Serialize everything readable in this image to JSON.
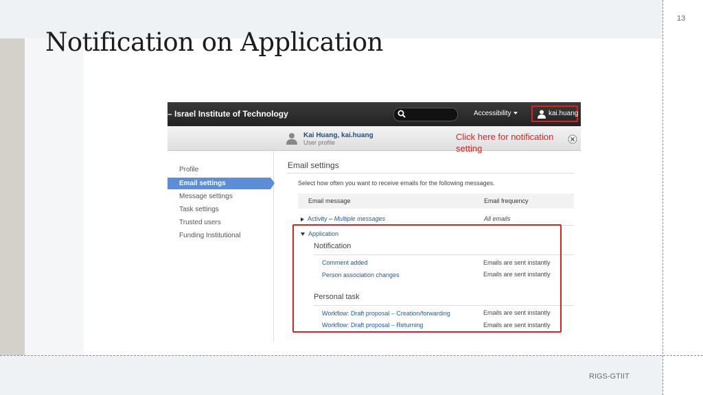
{
  "slide": {
    "title": "Notification on Application",
    "page_number": "13",
    "footer": "RIGS-GTIIT"
  },
  "screenshot": {
    "topbar": {
      "org_title": "– Israel Institute of Technology",
      "search_placeholder": "",
      "accessibility_label": "Accessibility",
      "user_label": "kai.huang"
    },
    "profile": {
      "name": "Kai Huang, kai.huang",
      "subtitle": "User profile"
    },
    "hint": "Click here for notification setting",
    "sidebar": {
      "items": [
        {
          "label": "Profile"
        },
        {
          "label": "Email settings"
        },
        {
          "label": "Message settings"
        },
        {
          "label": "Task settings"
        },
        {
          "label": "Trusted users"
        },
        {
          "label": "Funding Institutional"
        }
      ],
      "active_index": 1
    },
    "content": {
      "section_title": "Email settings",
      "description": "Select how often you want to receive emails for the following messages.",
      "columns": {
        "message": "Email message",
        "frequency": "Email frequency"
      },
      "activity": {
        "label": "Activity",
        "separator": "–",
        "detail": "Multiple messages",
        "frequency": "All emails"
      },
      "application": {
        "label": "Application",
        "groups": [
          {
            "title": "Notification",
            "rows": [
              {
                "label": "Comment added",
                "frequency": "Emails are sent instantly"
              },
              {
                "label": "Person association changes",
                "frequency": "Emails are sent instantly"
              }
            ]
          },
          {
            "title": "Personal task",
            "rows": [
              {
                "label": "Workflow: Draft proposal – Creation/forwarding",
                "frequency": "Emails are sent instantly"
              },
              {
                "label": "Workflow: Draft proposal – Returning",
                "frequency": "Emails are sent instantly"
              }
            ]
          }
        ]
      }
    },
    "colors": {
      "highlight": "#e02020",
      "link": "#1d5aa8",
      "active": "#5b8ed6"
    }
  }
}
